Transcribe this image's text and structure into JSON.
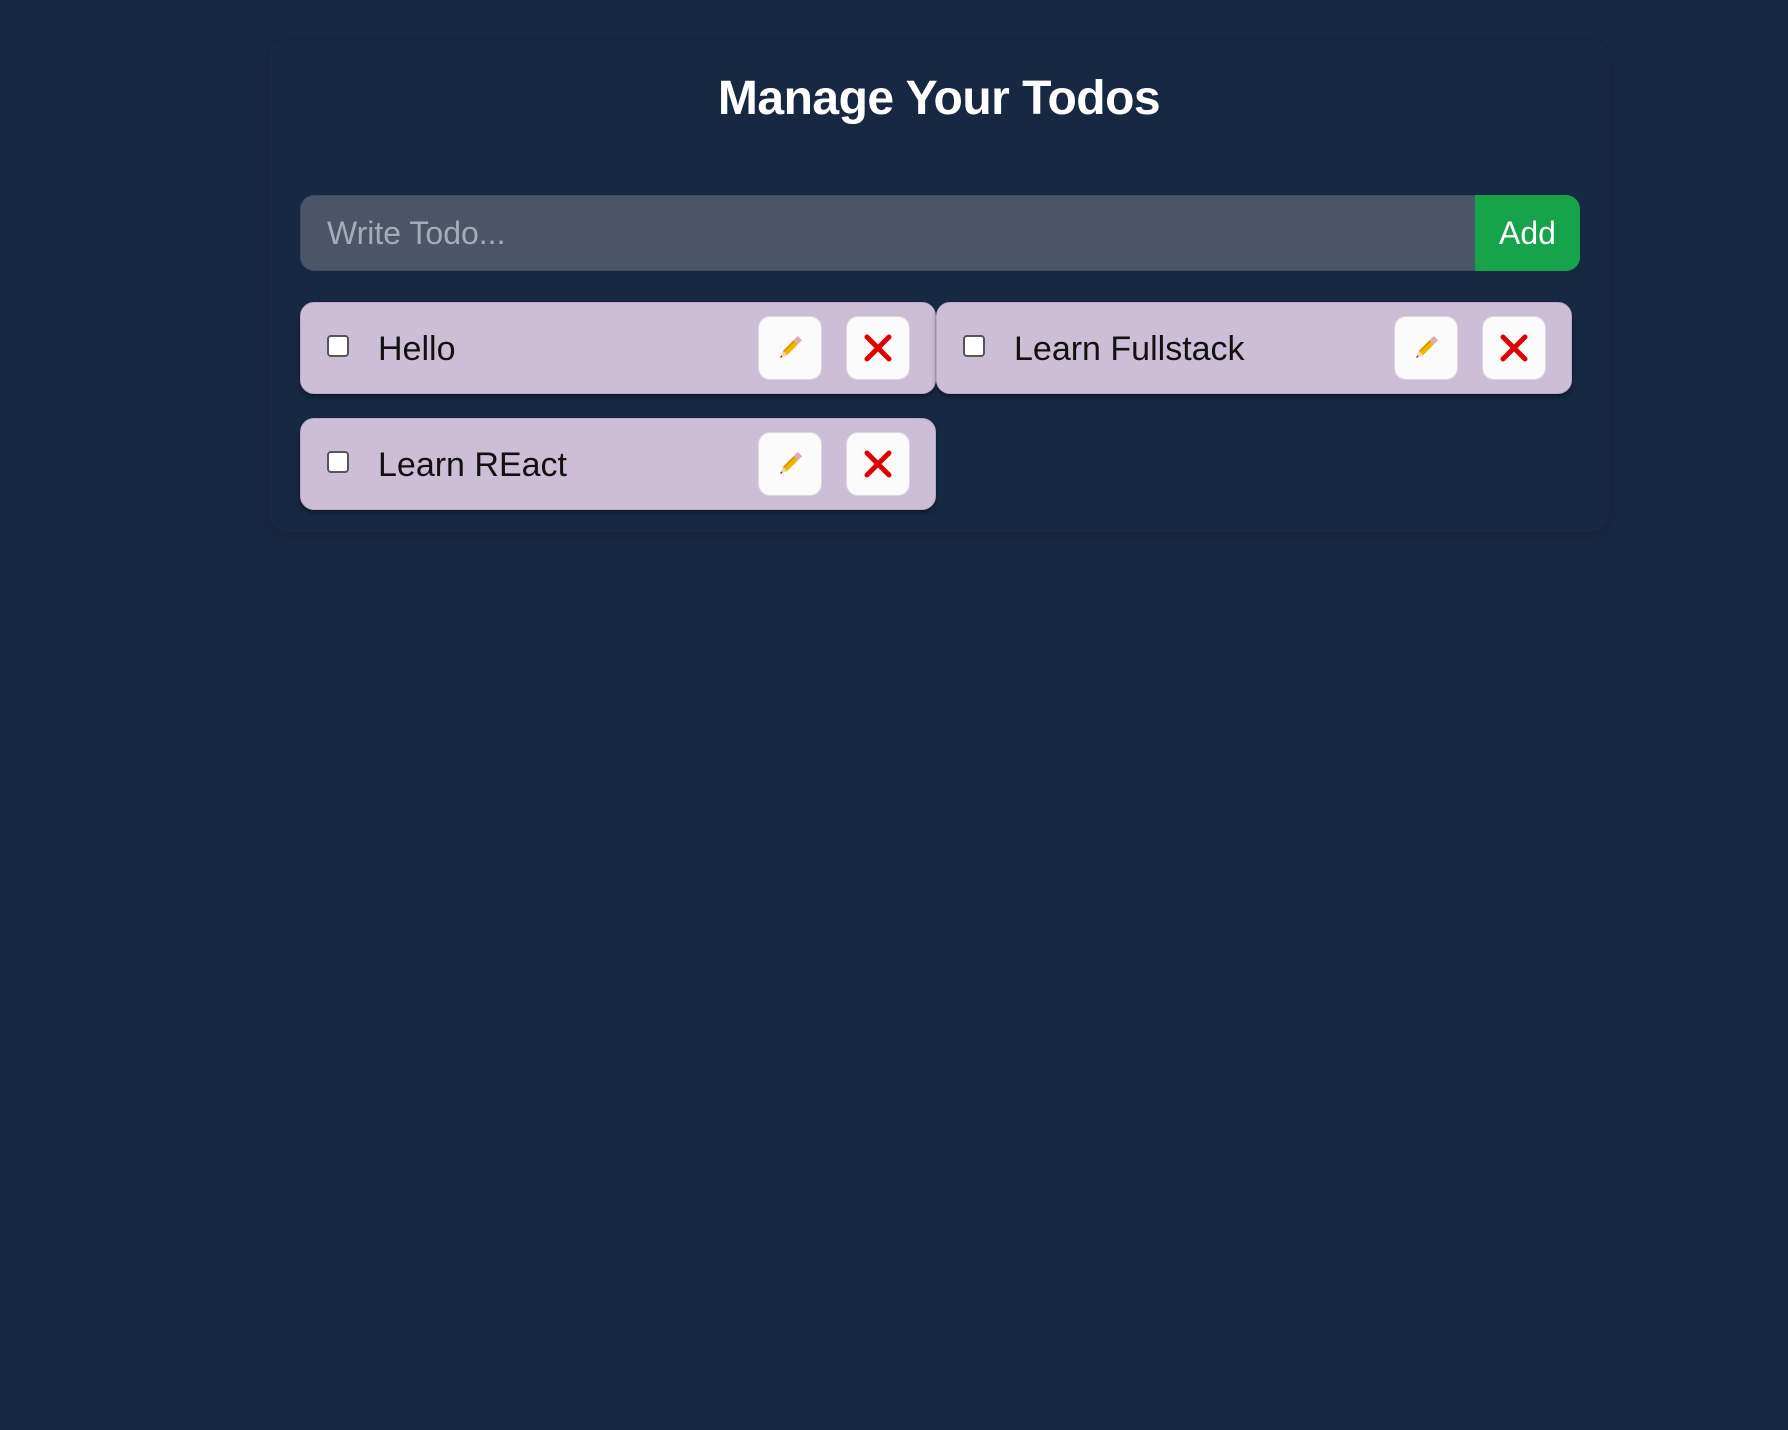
{
  "header": {
    "title": "Manage Your Todos"
  },
  "form": {
    "input_value": "",
    "input_placeholder": "Write Todo...",
    "add_label": "Add"
  },
  "todos": [
    {
      "text": "Hello",
      "completed": false
    },
    {
      "text": "Learn Fullstack",
      "completed": false
    },
    {
      "text": "Learn REact",
      "completed": false
    }
  ],
  "icons": {
    "edit": "pencil-icon",
    "delete": "close-icon"
  },
  "colors": {
    "background": "#172842",
    "input_background": "#4a5568",
    "add_button": "#16a34a",
    "todo_background": "#ccbed7",
    "delete_icon": "#e00000",
    "pencil_body": "#f2b400"
  }
}
